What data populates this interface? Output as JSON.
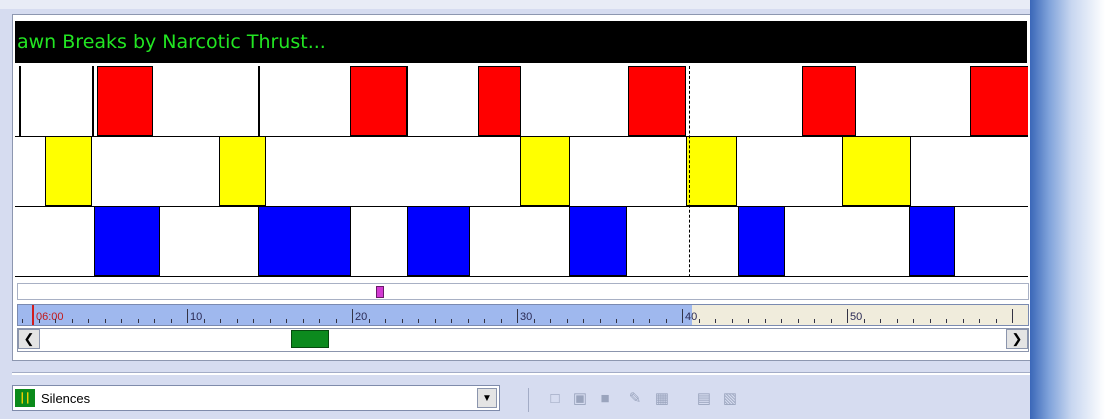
{
  "title": "awn Breaks by Narcotic Thrust...",
  "colors": {
    "title_bg": "#000000",
    "title_text": "#22e522",
    "lane_red": "#ff0000",
    "lane_yellow": "#ffff00",
    "lane_blue": "#0000ff",
    "ruler": "#9fb8ee",
    "ruler_future": "#f0ecdc",
    "scroll_thumb": "#0c8a1e",
    "marker": "#d23ad2"
  },
  "ruler": {
    "start_label": "06:00",
    "labels": [
      "10",
      "20",
      "30",
      "40",
      "50"
    ]
  },
  "timeline": {
    "lanes": [
      {
        "color": "red",
        "blocks": [
          [
            0,
            0.15
          ],
          [
            4.75,
            8.12
          ],
          [
            20.05,
            23.5
          ],
          [
            27.8,
            30.45
          ],
          [
            36.9,
            40.4
          ],
          [
            47.45,
            50.7
          ],
          [
            57.65,
            62
          ]
        ]
      },
      {
        "color": "yellow",
        "blocks": [
          [
            1.55,
            4.4
          ],
          [
            12.1,
            14.95
          ],
          [
            30.35,
            33.4
          ],
          [
            40.4,
            43.5
          ],
          [
            49.9,
            54.05
          ]
        ]
      },
      {
        "color": "blue",
        "blocks": [
          [
            4.55,
            8.55
          ],
          [
            14.5,
            20.1
          ],
          [
            23.5,
            27.35
          ],
          [
            33.35,
            36.85
          ],
          [
            43.55,
            46.45
          ],
          [
            53.95,
            56.75
          ]
        ]
      }
    ],
    "separators": [
      4.4,
      14.5,
      23.45
    ],
    "cursor_position": 40.6,
    "marker_position": 21.8,
    "scroll_thumb_fraction": 0.27
  },
  "dropdown": {
    "value": "Silences",
    "icon": "waveform-icon"
  },
  "toolbar": {
    "buttons": [
      "new-document-icon",
      "open-folder-icon",
      "save-icon",
      "wrench-icon",
      "clipboard-paste-icon",
      "chart-icon",
      "export-icon"
    ]
  }
}
